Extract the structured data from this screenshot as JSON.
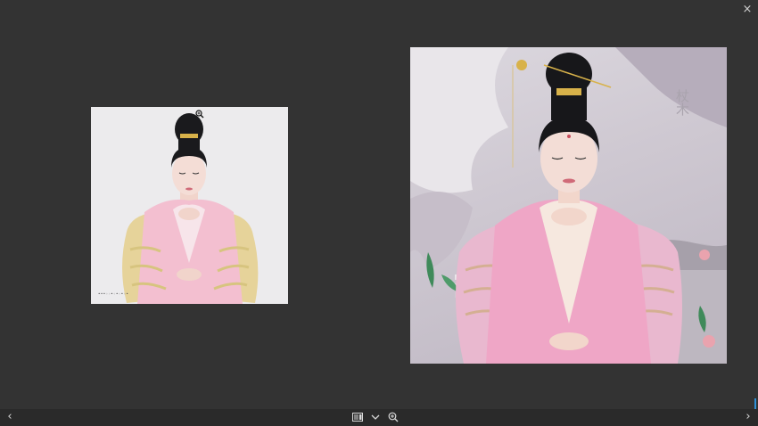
{
  "viewer": {
    "close_glyph": "×",
    "colors": {
      "background": "#333333",
      "toolbar": "#2a2a2a",
      "accent": "#2f8fd6"
    }
  },
  "images": {
    "left": {
      "description_icon": "portrait-image",
      "stamp_text": "•••◦◦•◦•◦•◦•"
    },
    "right": {
      "description_icon": "portrait-image",
      "vertical_text": "杖木"
    }
  },
  "toolbar": {
    "prev_glyph": "‹",
    "next_glyph": "›",
    "icons": [
      "gallery-icon",
      "chevron-down-icon",
      "zoom-in-icon"
    ]
  }
}
